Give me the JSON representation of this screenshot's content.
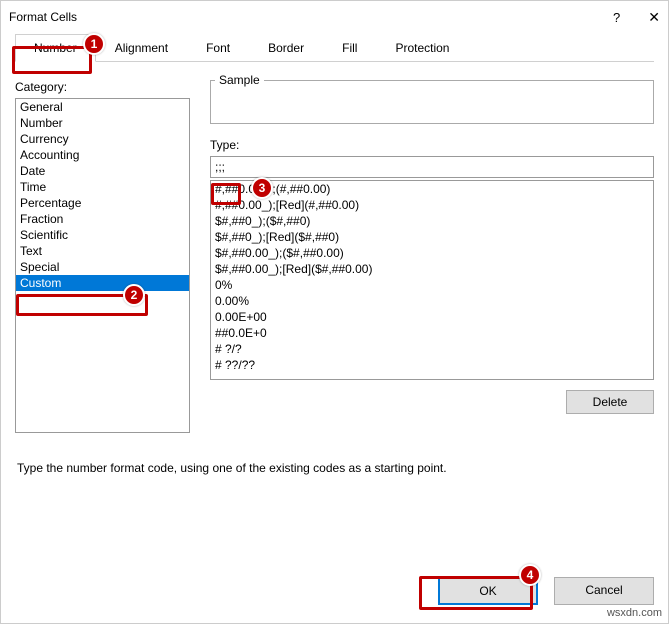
{
  "title": "Format Cells",
  "tabs": [
    "Number",
    "Alignment",
    "Font",
    "Border",
    "Fill",
    "Protection"
  ],
  "active_tab": 0,
  "category_label": "Category:",
  "categories": [
    "General",
    "Number",
    "Currency",
    "Accounting",
    "Date",
    "Time",
    "Percentage",
    "Fraction",
    "Scientific",
    "Text",
    "Special",
    "Custom"
  ],
  "selected_category": 11,
  "sample_label": "Sample",
  "sample_value": "",
  "type_label": "Type:",
  "type_value": ";;;",
  "formats": [
    "#,##0.00_);(#,##0.00)",
    "#,##0.00_);[Red](#,##0.00)",
    "$#,##0_);($#,##0)",
    "$#,##0_);[Red]($#,##0)",
    "$#,##0.00_);($#,##0.00)",
    "$#,##0.00_);[Red]($#,##0.00)",
    "0%",
    "0.00%",
    "0.00E+00",
    "##0.0E+0",
    "# ?/?",
    "# ??/??"
  ],
  "delete_label": "Delete",
  "hint": "Type the number format code, using one of the existing codes as a starting point.",
  "ok_label": "OK",
  "cancel_label": "Cancel",
  "callouts": {
    "c1": "1",
    "c2": "2",
    "c3": "3",
    "c4": "4"
  },
  "watermark": "wsxdn.com"
}
